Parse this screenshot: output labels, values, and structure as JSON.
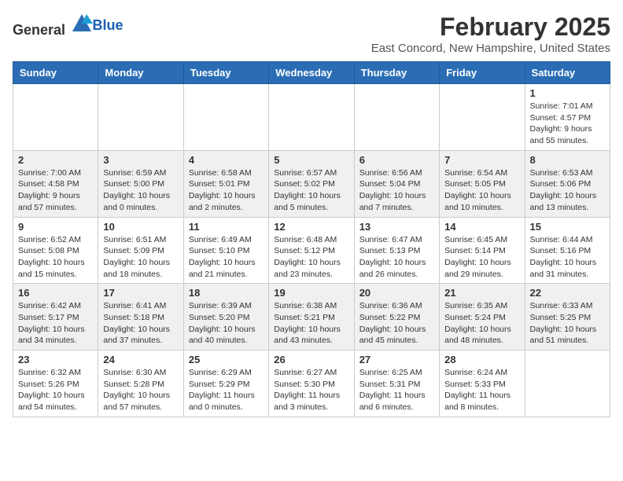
{
  "header": {
    "logo_general": "General",
    "logo_blue": "Blue",
    "title": "February 2025",
    "subtitle": "East Concord, New Hampshire, United States"
  },
  "calendar": {
    "days_of_week": [
      "Sunday",
      "Monday",
      "Tuesday",
      "Wednesday",
      "Thursday",
      "Friday",
      "Saturday"
    ],
    "weeks": [
      [
        {
          "day": "",
          "info": ""
        },
        {
          "day": "",
          "info": ""
        },
        {
          "day": "",
          "info": ""
        },
        {
          "day": "",
          "info": ""
        },
        {
          "day": "",
          "info": ""
        },
        {
          "day": "",
          "info": ""
        },
        {
          "day": "1",
          "info": "Sunrise: 7:01 AM\nSunset: 4:57 PM\nDaylight: 9 hours and 55 minutes."
        }
      ],
      [
        {
          "day": "2",
          "info": "Sunrise: 7:00 AM\nSunset: 4:58 PM\nDaylight: 9 hours and 57 minutes."
        },
        {
          "day": "3",
          "info": "Sunrise: 6:59 AM\nSunset: 5:00 PM\nDaylight: 10 hours and 0 minutes."
        },
        {
          "day": "4",
          "info": "Sunrise: 6:58 AM\nSunset: 5:01 PM\nDaylight: 10 hours and 2 minutes."
        },
        {
          "day": "5",
          "info": "Sunrise: 6:57 AM\nSunset: 5:02 PM\nDaylight: 10 hours and 5 minutes."
        },
        {
          "day": "6",
          "info": "Sunrise: 6:56 AM\nSunset: 5:04 PM\nDaylight: 10 hours and 7 minutes."
        },
        {
          "day": "7",
          "info": "Sunrise: 6:54 AM\nSunset: 5:05 PM\nDaylight: 10 hours and 10 minutes."
        },
        {
          "day": "8",
          "info": "Sunrise: 6:53 AM\nSunset: 5:06 PM\nDaylight: 10 hours and 13 minutes."
        }
      ],
      [
        {
          "day": "9",
          "info": "Sunrise: 6:52 AM\nSunset: 5:08 PM\nDaylight: 10 hours and 15 minutes."
        },
        {
          "day": "10",
          "info": "Sunrise: 6:51 AM\nSunset: 5:09 PM\nDaylight: 10 hours and 18 minutes."
        },
        {
          "day": "11",
          "info": "Sunrise: 6:49 AM\nSunset: 5:10 PM\nDaylight: 10 hours and 21 minutes."
        },
        {
          "day": "12",
          "info": "Sunrise: 6:48 AM\nSunset: 5:12 PM\nDaylight: 10 hours and 23 minutes."
        },
        {
          "day": "13",
          "info": "Sunrise: 6:47 AM\nSunset: 5:13 PM\nDaylight: 10 hours and 26 minutes."
        },
        {
          "day": "14",
          "info": "Sunrise: 6:45 AM\nSunset: 5:14 PM\nDaylight: 10 hours and 29 minutes."
        },
        {
          "day": "15",
          "info": "Sunrise: 6:44 AM\nSunset: 5:16 PM\nDaylight: 10 hours and 31 minutes."
        }
      ],
      [
        {
          "day": "16",
          "info": "Sunrise: 6:42 AM\nSunset: 5:17 PM\nDaylight: 10 hours and 34 minutes."
        },
        {
          "day": "17",
          "info": "Sunrise: 6:41 AM\nSunset: 5:18 PM\nDaylight: 10 hours and 37 minutes."
        },
        {
          "day": "18",
          "info": "Sunrise: 6:39 AM\nSunset: 5:20 PM\nDaylight: 10 hours and 40 minutes."
        },
        {
          "day": "19",
          "info": "Sunrise: 6:38 AM\nSunset: 5:21 PM\nDaylight: 10 hours and 43 minutes."
        },
        {
          "day": "20",
          "info": "Sunrise: 6:36 AM\nSunset: 5:22 PM\nDaylight: 10 hours and 45 minutes."
        },
        {
          "day": "21",
          "info": "Sunrise: 6:35 AM\nSunset: 5:24 PM\nDaylight: 10 hours and 48 minutes."
        },
        {
          "day": "22",
          "info": "Sunrise: 6:33 AM\nSunset: 5:25 PM\nDaylight: 10 hours and 51 minutes."
        }
      ],
      [
        {
          "day": "23",
          "info": "Sunrise: 6:32 AM\nSunset: 5:26 PM\nDaylight: 10 hours and 54 minutes."
        },
        {
          "day": "24",
          "info": "Sunrise: 6:30 AM\nSunset: 5:28 PM\nDaylight: 10 hours and 57 minutes."
        },
        {
          "day": "25",
          "info": "Sunrise: 6:29 AM\nSunset: 5:29 PM\nDaylight: 11 hours and 0 minutes."
        },
        {
          "day": "26",
          "info": "Sunrise: 6:27 AM\nSunset: 5:30 PM\nDaylight: 11 hours and 3 minutes."
        },
        {
          "day": "27",
          "info": "Sunrise: 6:25 AM\nSunset: 5:31 PM\nDaylight: 11 hours and 6 minutes."
        },
        {
          "day": "28",
          "info": "Sunrise: 6:24 AM\nSunset: 5:33 PM\nDaylight: 11 hours and 8 minutes."
        },
        {
          "day": "",
          "info": ""
        }
      ]
    ]
  }
}
